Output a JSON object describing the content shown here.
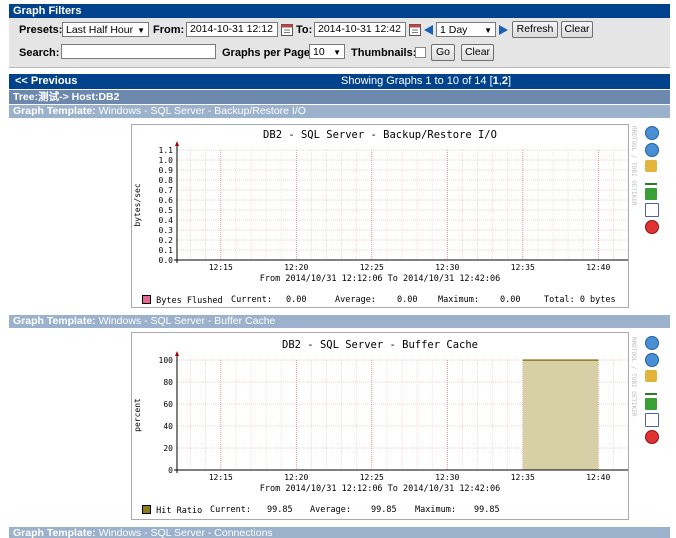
{
  "filters": {
    "title": "Graph Filters",
    "presets_label": "Presets:",
    "presets_value": "Last Half Hour",
    "from_label": "From:",
    "from_value": "2014-10-31 12:12",
    "to_label": "To:",
    "to_value": "2014-10-31 12:42",
    "shift_value": "1 Day",
    "refresh_label": "Refresh",
    "clear_label": "Clear",
    "search_label": "Search:",
    "search_value": "",
    "graphs_per_page_label": "Graphs per Page:",
    "graphs_per_page_value": "10",
    "thumbnails_label": "Thumbnails:",
    "go_label": "Go",
    "clear2_label": "Clear"
  },
  "nav": {
    "previous_label": "<< Previous",
    "showing_prefix": "Showing Graphs 1 to 10 of 14 [",
    "page1": "1",
    "comma": ",",
    "page2": "2",
    "showing_suffix": "]"
  },
  "tree": {
    "label": "Tree:测试-> Host:DB2"
  },
  "graphs": [
    {
      "template_label": "Graph Template:",
      "template_name": "Windows - SQL Server - Backup/Restore I/O",
      "title": "DB2 - SQL Server - Backup/Restore I/O",
      "ylabel": "bytes/sec",
      "yticks": [
        "1.1",
        "1.0",
        "0.9",
        "0.8",
        "0.7",
        "0.6",
        "0.5",
        "0.4",
        "0.3",
        "0.2",
        "0.1",
        "0.0"
      ],
      "xticks": [
        "12:15",
        "12:20",
        "12:25",
        "12:30",
        "12:35",
        "12:40"
      ],
      "range_text": "From 2014/10/31 12:12:06 To 2014/10/31 12:42:06",
      "legend": {
        "name": "Bytes Flushed",
        "color": "#e86494",
        "current_label": "Current:",
        "current": "0.00",
        "average_label": "Average:",
        "average": "0.00",
        "maximum_label": "Maximum:",
        "maximum": "0.00",
        "total": "Total: 0 bytes"
      }
    },
    {
      "template_label": "Graph Template:",
      "template_name": "Windows - SQL Server - Buffer Cache",
      "title": "DB2 - SQL Server - Buffer Cache",
      "ylabel": "percent",
      "yticks": [
        "100",
        "80",
        "60",
        "40",
        "20",
        "0"
      ],
      "xticks": [
        "12:15",
        "12:20",
        "12:25",
        "12:30",
        "12:35",
        "12:40"
      ],
      "range_text": "From 2014/10/31 12:12:06 To 2014/10/31 12:42:06",
      "legend": {
        "name": "Hit Ratio",
        "color": "#8f7a1a",
        "current_label": "Current:",
        "current": "99.85",
        "average_label": "Average:",
        "average": "99.85",
        "maximum_label": "Maximum:",
        "maximum": "99.85",
        "total": ""
      }
    },
    {
      "template_label": "Graph Template:",
      "template_name": "Windows - SQL Server - Connections"
    }
  ],
  "rrdtool_text": "RRDTOOL / TOBI OETIKER",
  "chart_data": [
    {
      "type": "line",
      "title": "DB2 - SQL Server - Backup/Restore I/O",
      "xlabel": "",
      "ylabel": "bytes/sec",
      "x": [
        "12:15",
        "12:20",
        "12:25",
        "12:30",
        "12:35",
        "12:40"
      ],
      "ylim": [
        0,
        1.1
      ],
      "series": [
        {
          "name": "Bytes Flushed",
          "values": [
            0,
            0,
            0,
            0,
            0,
            0
          ]
        }
      ],
      "grid": true,
      "legend": "bottom"
    },
    {
      "type": "area",
      "title": "DB2 - SQL Server - Buffer Cache",
      "xlabel": "",
      "ylabel": "percent",
      "x": [
        "12:35",
        "12:40"
      ],
      "ylim": [
        0,
        100
      ],
      "series": [
        {
          "name": "Hit Ratio",
          "values": [
            99.85,
            99.85
          ]
        }
      ],
      "grid": true,
      "legend": "bottom"
    }
  ]
}
